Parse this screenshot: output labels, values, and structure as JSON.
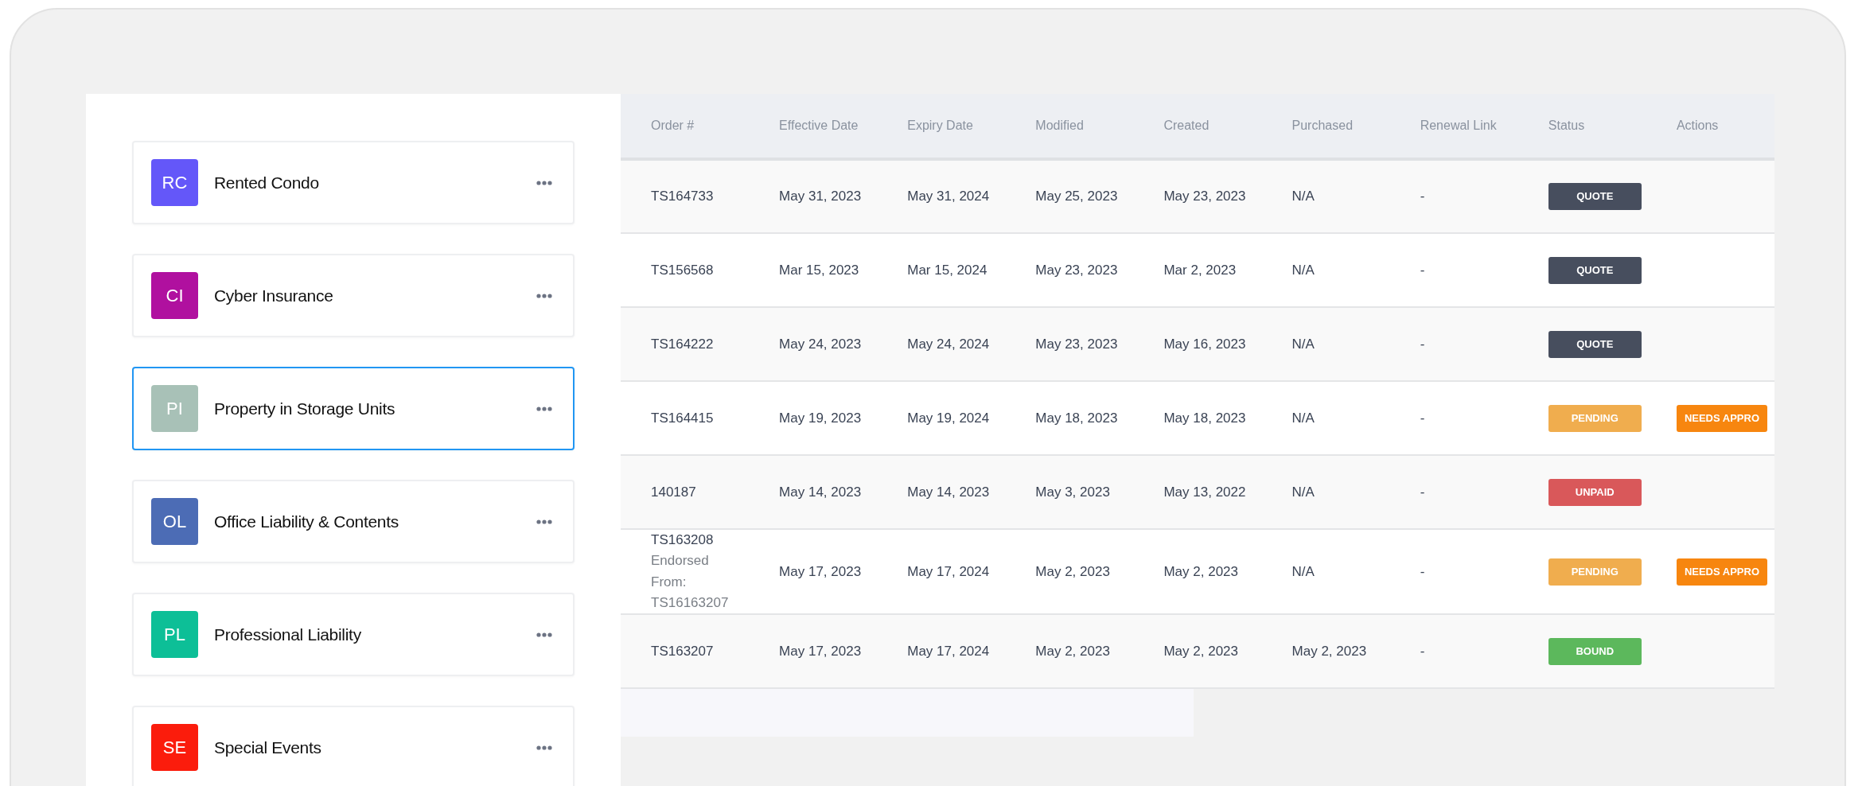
{
  "products": [
    {
      "initials": "RC",
      "name": "Rented Condo",
      "color": "#6457f9",
      "selected": false
    },
    {
      "initials": "CI",
      "name": "Cyber Insurance",
      "color": "#b0109f",
      "selected": false
    },
    {
      "initials": "PI",
      "name": "Property in Storage Units",
      "color": "#a8c1b7",
      "selected": true
    },
    {
      "initials": "OL",
      "name": "Office Liability & Contents",
      "color": "#4c6cb5",
      "selected": false
    },
    {
      "initials": "PL",
      "name": "Professional Liability",
      "color": "#0dbf97",
      "selected": false
    },
    {
      "initials": "SE",
      "name": "Special Events",
      "color": "#fb1c0c",
      "selected": false
    }
  ],
  "table": {
    "columns": [
      "Order #",
      "Effective Date",
      "Expiry Date",
      "Modified",
      "Created",
      "Purchased",
      "Renewal Link",
      "Status",
      "Actions"
    ],
    "rows": [
      {
        "order": "TS164733",
        "effective": "May 31, 2023",
        "expiry": "May 31, 2024",
        "modified": "May 25, 2023",
        "created": "May 23, 2023",
        "purchased": "N/A",
        "renewal": "-",
        "status": {
          "label": "QUOTE",
          "kind": "quote"
        }
      },
      {
        "order": "TS156568",
        "effective": "Mar 15, 2023",
        "expiry": "Mar 15, 2024",
        "modified": "May 23, 2023",
        "created": "Mar 2, 2023",
        "purchased": "N/A",
        "renewal": "-",
        "status": {
          "label": "QUOTE",
          "kind": "quote"
        }
      },
      {
        "order": "TS164222",
        "effective": "May 24, 2023",
        "expiry": "May 24, 2024",
        "modified": "May 23, 2023",
        "created": "May 16, 2023",
        "purchased": "N/A",
        "renewal": "-",
        "status": {
          "label": "QUOTE",
          "kind": "quote"
        }
      },
      {
        "order": "TS164415",
        "effective": "May 19, 2023",
        "expiry": "May 19, 2024",
        "modified": "May 18, 2023",
        "created": "May 18, 2023",
        "purchased": "N/A",
        "renewal": "-",
        "status": {
          "label": "PENDING",
          "kind": "pending"
        },
        "action": "NEEDS APPRO"
      },
      {
        "order": "140187",
        "effective": "May 14, 2023",
        "expiry": "May 14, 2023",
        "modified": "May 3, 2023",
        "created": "May 13, 2022",
        "purchased": "N/A",
        "renewal": "-",
        "status": {
          "label": "UNPAID",
          "kind": "unpaid"
        }
      },
      {
        "order": "TS163208",
        "note": "Endorsed From: TS16163207",
        "effective": "May 17, 2023",
        "expiry": "May 17, 2024",
        "modified": "May 2, 2023",
        "created": "May 2, 2023",
        "purchased": "N/A",
        "renewal": "-",
        "status": {
          "label": "PENDING",
          "kind": "pending"
        },
        "action": "NEEDS APPRO"
      },
      {
        "order": "TS163207",
        "effective": "May 17, 2023",
        "expiry": "May 17, 2024",
        "modified": "May 2, 2023",
        "created": "May 2, 2023",
        "purchased": "May 2, 2023",
        "renewal": "-",
        "status": {
          "label": "BOUND",
          "kind": "bound"
        }
      }
    ]
  }
}
